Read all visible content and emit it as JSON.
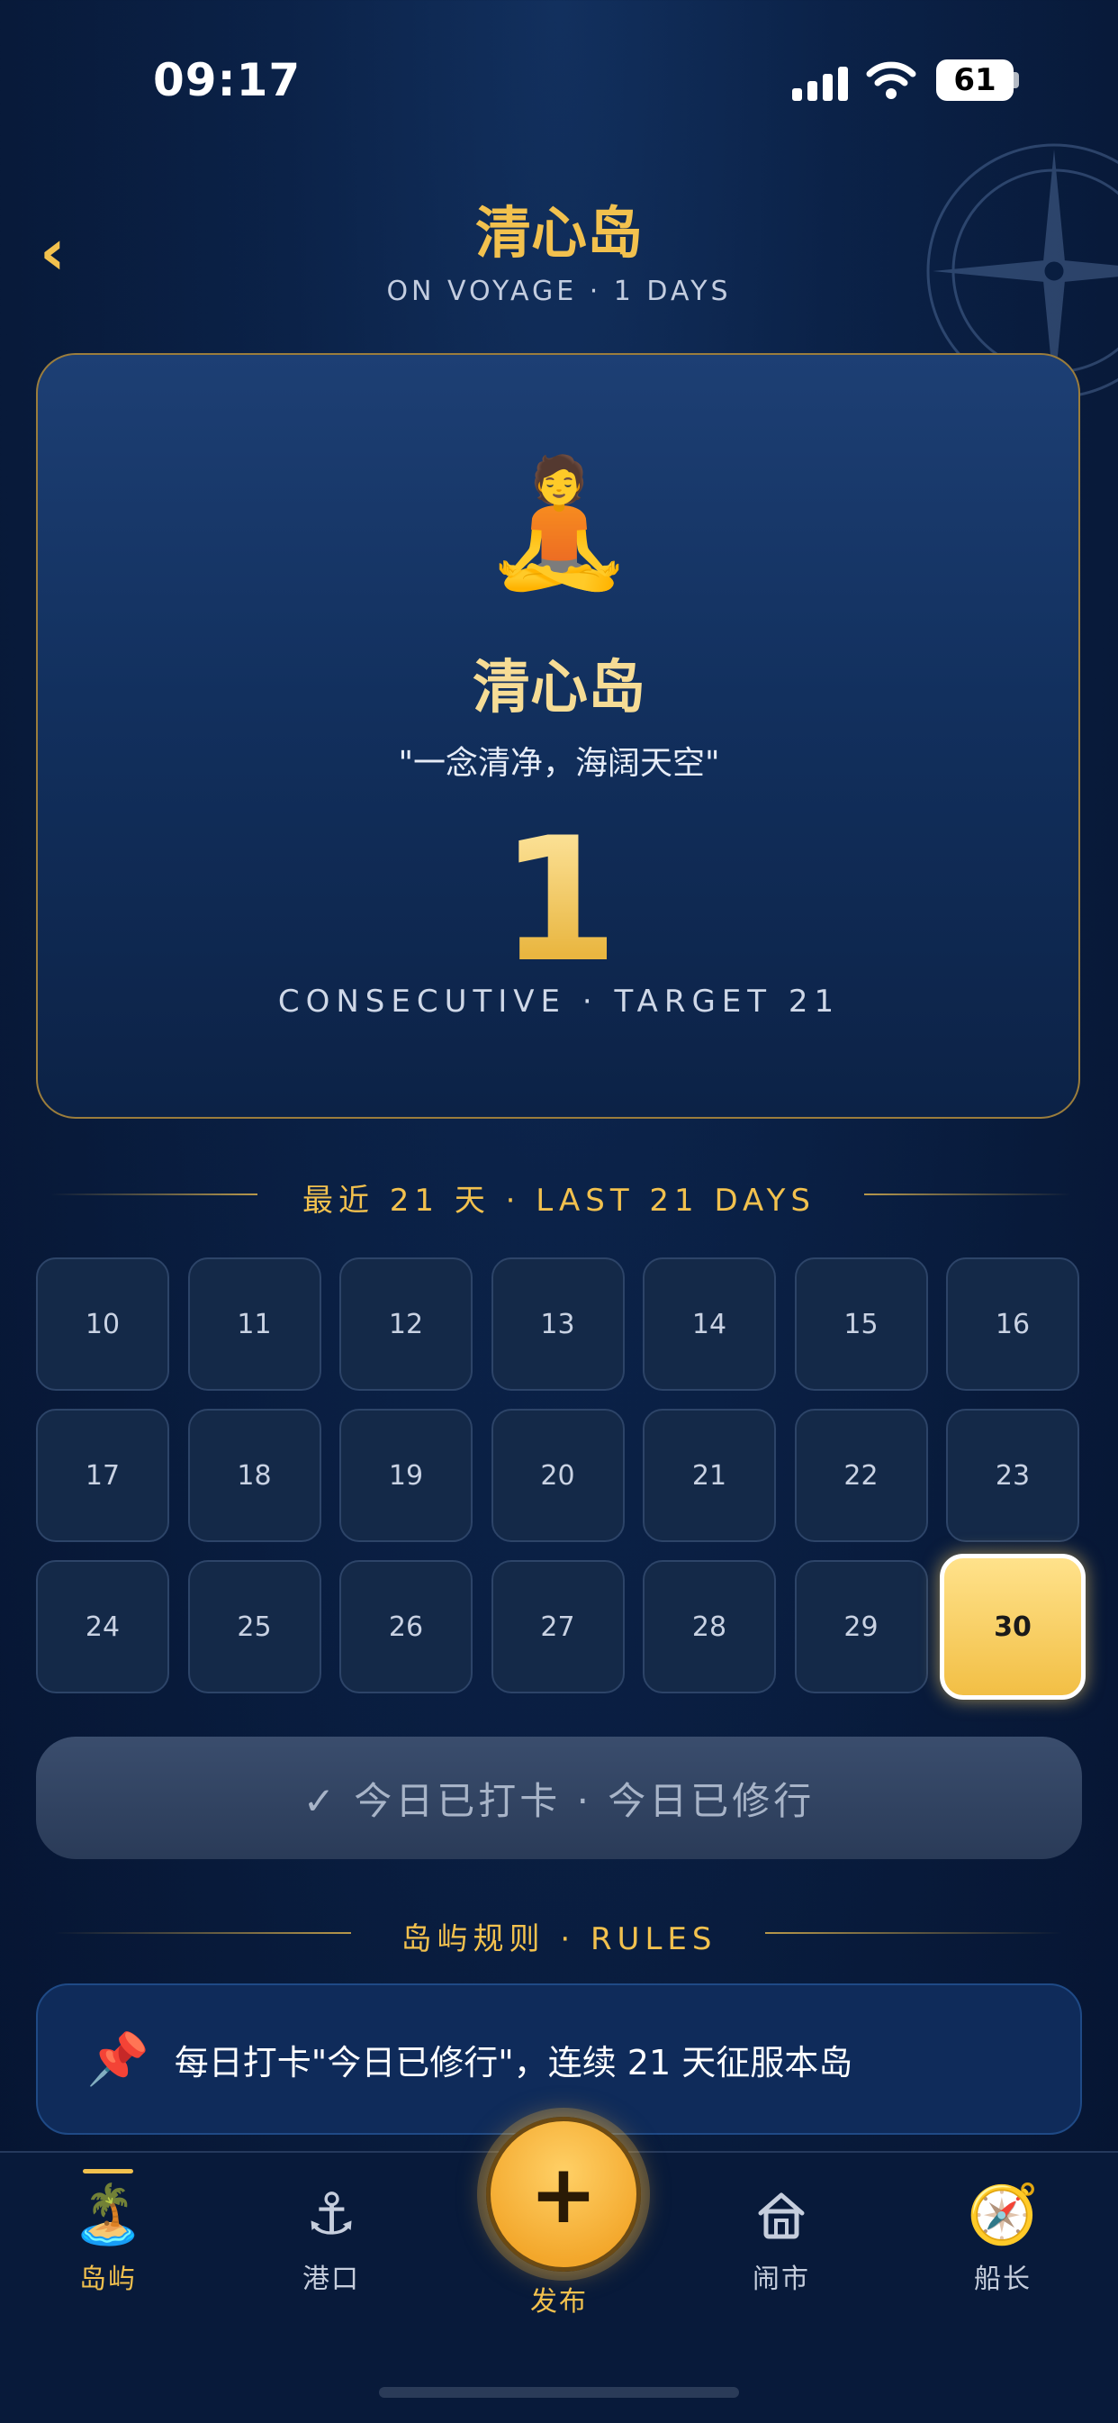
{
  "status_bar": {
    "time": "09:17",
    "battery": "61"
  },
  "header": {
    "back_icon": "chevron-left-icon",
    "title": "清心岛",
    "subtitle": "ON VOYAGE · 1 DAYS"
  },
  "hero": {
    "emoji": "🧘",
    "name": "清心岛",
    "quote": "\"一念清净，海阔天空\"",
    "streak": "1",
    "footer": "CONSECUTIVE · TARGET 21"
  },
  "history": {
    "heading": "最近 21 天 · LAST 21 DAYS",
    "days": [
      "10",
      "11",
      "12",
      "13",
      "14",
      "15",
      "16",
      "17",
      "18",
      "19",
      "20",
      "21",
      "22",
      "23",
      "24",
      "25",
      "26",
      "27",
      "28",
      "29",
      "30"
    ],
    "selected_day": "30"
  },
  "checkin": {
    "label": "✓ 今日已打卡 · 今日已修行"
  },
  "rules": {
    "heading": "岛屿规则 · RULES",
    "pin_icon": "📌",
    "text": "每日打卡\"今日已修行\"，连续 21 天征服本岛"
  },
  "tabbar": {
    "tabs": [
      {
        "label": "岛屿",
        "icon": "🏝️",
        "active": true
      },
      {
        "label": "港口",
        "icon": "⚓",
        "active": false
      },
      {
        "label": "发布",
        "icon": "+",
        "active": false
      },
      {
        "label": "闹市",
        "icon": "house-icon",
        "active": false
      },
      {
        "label": "船长",
        "icon": "🧭",
        "active": false
      }
    ]
  },
  "colors": {
    "accent_gold": "#f2c14e",
    "background": "#0b2248",
    "card_border": "#9b7d3c"
  }
}
